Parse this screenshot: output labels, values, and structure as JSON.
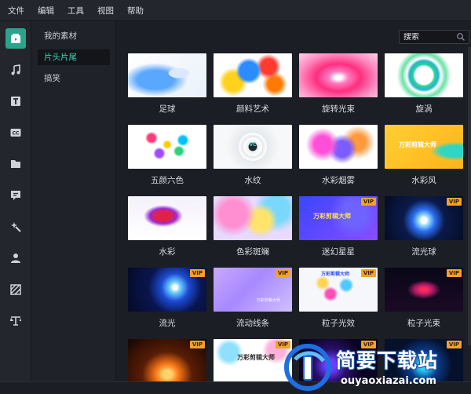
{
  "menu": [
    "文件",
    "编辑",
    "工具",
    "视图",
    "帮助"
  ],
  "rail": [
    {
      "icon": "media-icon",
      "active": true
    },
    {
      "icon": "music-note-icon"
    },
    {
      "icon": "text-icon"
    },
    {
      "icon": "subtitles-cc-icon"
    },
    {
      "icon": "folder-icon"
    },
    {
      "icon": "comment-icon"
    },
    {
      "icon": "magic-wand-icon"
    },
    {
      "icon": "person-icon"
    },
    {
      "icon": "filter-icon"
    },
    {
      "icon": "balance-icon"
    }
  ],
  "categories": [
    {
      "label": "我的素材",
      "active": false
    },
    {
      "label": "片头片尾",
      "active": true
    },
    {
      "label": "搞笑",
      "active": false
    }
  ],
  "search": {
    "placeholder": "搜索"
  },
  "items": [
    {
      "label": "足球",
      "vip": false
    },
    {
      "label": "颜料艺术",
      "vip": false
    },
    {
      "label": "旋转光束",
      "vip": false
    },
    {
      "label": "旋涡",
      "vip": false
    },
    {
      "label": "五颜六色",
      "vip": false
    },
    {
      "label": "水纹",
      "vip": false,
      "thumb_text": "VC"
    },
    {
      "label": "水彩烟雾",
      "vip": false
    },
    {
      "label": "水彩风",
      "vip": false,
      "thumb_text": "万彩剪辑大师"
    },
    {
      "label": "水彩",
      "vip": false
    },
    {
      "label": "色彩斑斓",
      "vip": false
    },
    {
      "label": "迷幻星星",
      "vip": true,
      "thumb_text": "万彩剪辑大师"
    },
    {
      "label": "流光球",
      "vip": true
    },
    {
      "label": "流光",
      "vip": true
    },
    {
      "label": "流动线条",
      "vip": true,
      "thumb_text": "万彩剪辑大师"
    },
    {
      "label": "粒子光效",
      "vip": true,
      "thumb_text": "万彩剪辑大师"
    },
    {
      "label": "粒子光束",
      "vip": true
    },
    {
      "label": "",
      "vip": true
    },
    {
      "label": "",
      "vip": true,
      "thumb_text": "万彩剪辑大师"
    },
    {
      "label": "",
      "vip": true
    },
    {
      "label": "",
      "vip": true
    }
  ],
  "vip_badge": "VIP",
  "watermark": {
    "title": "简要下载站",
    "url": "ouyaoxiazai.com"
  },
  "colors": {
    "accent": "#2aa58c",
    "active_text": "#36d6b1",
    "vip": "#f0a22a"
  }
}
